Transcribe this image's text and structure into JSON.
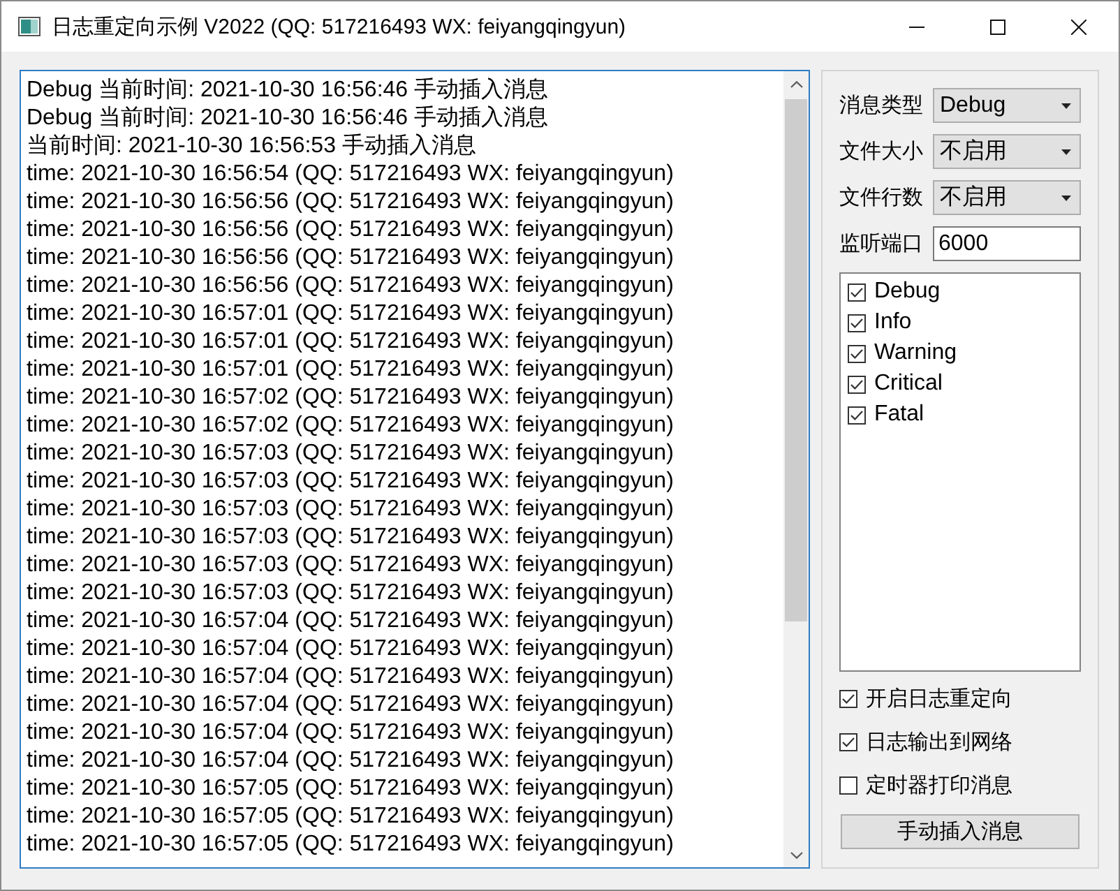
{
  "window": {
    "title": "日志重定向示例 V2022 (QQ: 517216493 WX: feiyangqingyun)"
  },
  "log": {
    "lines": [
      "Debug 当前时间: 2021-10-30 16:56:46 手动插入消息",
      "Debug 当前时间: 2021-10-30 16:56:46 手动插入消息",
      "当前时间: 2021-10-30 16:56:53 手动插入消息",
      "time: 2021-10-30 16:56:54 (QQ: 517216493 WX: feiyangqingyun)",
      "time: 2021-10-30 16:56:56 (QQ: 517216493 WX: feiyangqingyun)",
      "time: 2021-10-30 16:56:56 (QQ: 517216493 WX: feiyangqingyun)",
      "time: 2021-10-30 16:56:56 (QQ: 517216493 WX: feiyangqingyun)",
      "time: 2021-10-30 16:56:56 (QQ: 517216493 WX: feiyangqingyun)",
      "time: 2021-10-30 16:57:01 (QQ: 517216493 WX: feiyangqingyun)",
      "time: 2021-10-30 16:57:01 (QQ: 517216493 WX: feiyangqingyun)",
      "time: 2021-10-30 16:57:01 (QQ: 517216493 WX: feiyangqingyun)",
      "time: 2021-10-30 16:57:02 (QQ: 517216493 WX: feiyangqingyun)",
      "time: 2021-10-30 16:57:02 (QQ: 517216493 WX: feiyangqingyun)",
      "time: 2021-10-30 16:57:03 (QQ: 517216493 WX: feiyangqingyun)",
      "time: 2021-10-30 16:57:03 (QQ: 517216493 WX: feiyangqingyun)",
      "time: 2021-10-30 16:57:03 (QQ: 517216493 WX: feiyangqingyun)",
      "time: 2021-10-30 16:57:03 (QQ: 517216493 WX: feiyangqingyun)",
      "time: 2021-10-30 16:57:03 (QQ: 517216493 WX: feiyangqingyun)",
      "time: 2021-10-30 16:57:03 (QQ: 517216493 WX: feiyangqingyun)",
      "time: 2021-10-30 16:57:04 (QQ: 517216493 WX: feiyangqingyun)",
      "time: 2021-10-30 16:57:04 (QQ: 517216493 WX: feiyangqingyun)",
      "time: 2021-10-30 16:57:04 (QQ: 517216493 WX: feiyangqingyun)",
      "time: 2021-10-30 16:57:04 (QQ: 517216493 WX: feiyangqingyun)",
      "time: 2021-10-30 16:57:04 (QQ: 517216493 WX: feiyangqingyun)",
      "time: 2021-10-30 16:57:04 (QQ: 517216493 WX: feiyangqingyun)",
      "time: 2021-10-30 16:57:05 (QQ: 517216493 WX: feiyangqingyun)",
      "time: 2021-10-30 16:57:05 (QQ: 517216493 WX: feiyangqingyun)",
      "time: 2021-10-30 16:57:05 (QQ: 517216493 WX: feiyangqingyun)"
    ]
  },
  "settings": {
    "fields": [
      {
        "kind": "combo",
        "label": "消息类型",
        "value": "Debug"
      },
      {
        "kind": "combo",
        "label": "文件大小",
        "value": "不启用"
      },
      {
        "kind": "combo",
        "label": "文件行数",
        "value": "不启用"
      },
      {
        "kind": "input",
        "label": "监听端口",
        "value": "6000"
      }
    ],
    "levels": [
      {
        "label": "Debug",
        "checked": true
      },
      {
        "label": "Info",
        "checked": true
      },
      {
        "label": "Warning",
        "checked": true
      },
      {
        "label": "Critical",
        "checked": true
      },
      {
        "label": "Fatal",
        "checked": true
      }
    ],
    "options": [
      {
        "label": "开启日志重定向",
        "checked": true
      },
      {
        "label": "日志输出到网络",
        "checked": true
      },
      {
        "label": "定时器打印消息",
        "checked": false
      }
    ],
    "insert_button": "手动插入消息"
  }
}
